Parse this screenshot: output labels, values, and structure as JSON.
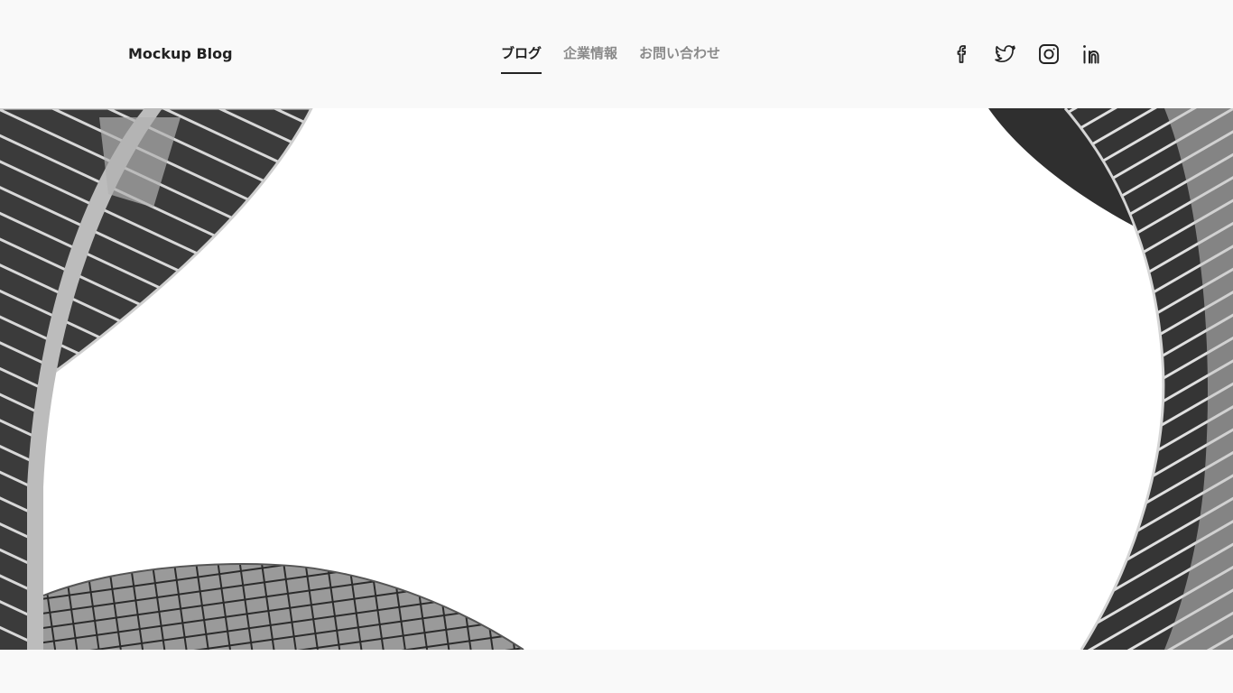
{
  "header": {
    "logo": "Mockup Blog",
    "nav": [
      {
        "label": "ブログ",
        "active": true
      },
      {
        "label": "企業情報",
        "active": false
      },
      {
        "label": "お問い合わせ",
        "active": false
      }
    ],
    "social": [
      {
        "icon": "facebook-icon"
      },
      {
        "icon": "twitter-icon"
      },
      {
        "icon": "instagram-icon"
      },
      {
        "icon": "linkedin-icon"
      }
    ]
  },
  "hero": {
    "image": "grayscale-architecture-spiral-photo"
  },
  "colors": {
    "text": "#222222",
    "nav_inactive": "#8a8a8a",
    "header_bg": "#f9f9f9"
  }
}
